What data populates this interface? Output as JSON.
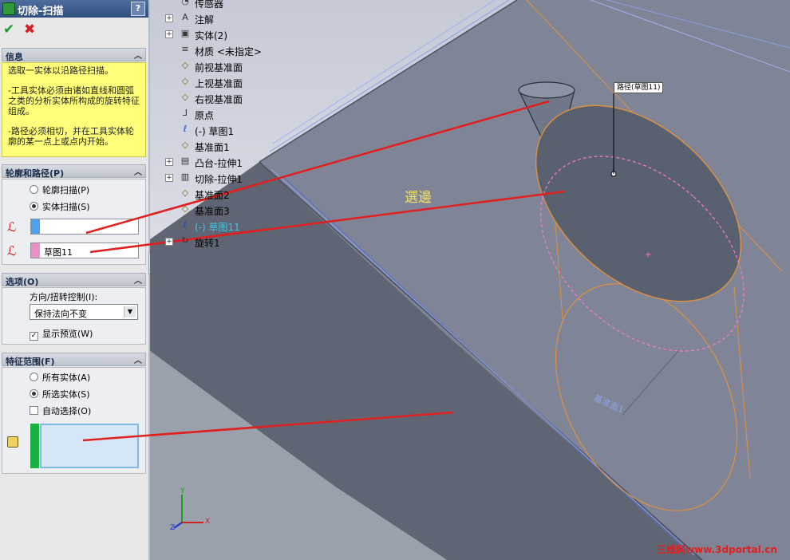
{
  "pm": {
    "title": "切除-扫描",
    "help": "?",
    "ok": "✔",
    "cancel": "✖",
    "info": {
      "header": "信息",
      "lines": [
        "选取一实体以沿路径扫描。",
        "-工具实体必须由诸如直线和圆弧之类的分析实体所构成的旋转特征组成。",
        "-路径必须相切，并在工具实体轮廓的某一点上或点内开始。"
      ]
    },
    "profile": {
      "header": "轮廓和路径(P)",
      "radio1": "轮廓扫描(P)",
      "radio2": "实体扫描(S)",
      "tool_value": "",
      "path_value": "草图11"
    },
    "options": {
      "header": "选项(O)",
      "dir_label": "方向/扭转控制(I):",
      "dir_value": "保持法向不变",
      "preview": "显示预览(W)"
    },
    "scope": {
      "header": "特征范围(F)",
      "radio1": "所有实体(A)",
      "radio2": "所选实体(S)",
      "auto": "自动选择(O)"
    }
  },
  "tree": [
    {
      "label": "传感器",
      "icon": "sensor-icon",
      "expand": false
    },
    {
      "label": "注解",
      "icon": "annotation-icon",
      "expand": true
    },
    {
      "label": "实体(2)",
      "icon": "solid-bodies-icon",
      "expand": true
    },
    {
      "label": "材质 <未指定>",
      "icon": "material-icon",
      "expand": false
    },
    {
      "label": "前视基准面",
      "icon": "plane-icon",
      "expand": false
    },
    {
      "label": "上视基准面",
      "icon": "plane-icon",
      "expand": false
    },
    {
      "label": "右视基准面",
      "icon": "plane-icon",
      "expand": false
    },
    {
      "label": "原点",
      "icon": "origin-icon",
      "expand": false
    },
    {
      "label": "(-) 草图1",
      "icon": "sketch-icon",
      "expand": false
    },
    {
      "label": "基准面1",
      "icon": "plane-icon",
      "expand": false
    },
    {
      "label": "凸台-拉伸1",
      "icon": "extrude-icon",
      "expand": true
    },
    {
      "label": "切除-拉伸1",
      "icon": "cut-extrude-icon",
      "expand": true
    },
    {
      "label": "基准面2",
      "icon": "plane-icon",
      "expand": false
    },
    {
      "label": "基准面3",
      "icon": "plane-icon",
      "expand": false
    },
    {
      "label": "(-) 草图11",
      "icon": "sketch-icon",
      "expand": false
    },
    {
      "label": "旋转1",
      "icon": "revolve-icon",
      "expand": true
    }
  ],
  "viewport": {
    "callout": "路径(草图11)",
    "annotation": "選邊",
    "plane_label": "基准面1",
    "axis_x": "X",
    "axis_y": "Y",
    "axis_z": "Z",
    "watermark": "三维网www.3dportal.cn"
  },
  "colors": {
    "titlebar": "#3a5a8c",
    "info_bg": "#ffff7a",
    "body_gray": "#5f6573",
    "face_gray": "#7f8596",
    "annotation_red": "#e02020",
    "selection_pink": "#f07ac8",
    "path_orange": "#e09040"
  }
}
